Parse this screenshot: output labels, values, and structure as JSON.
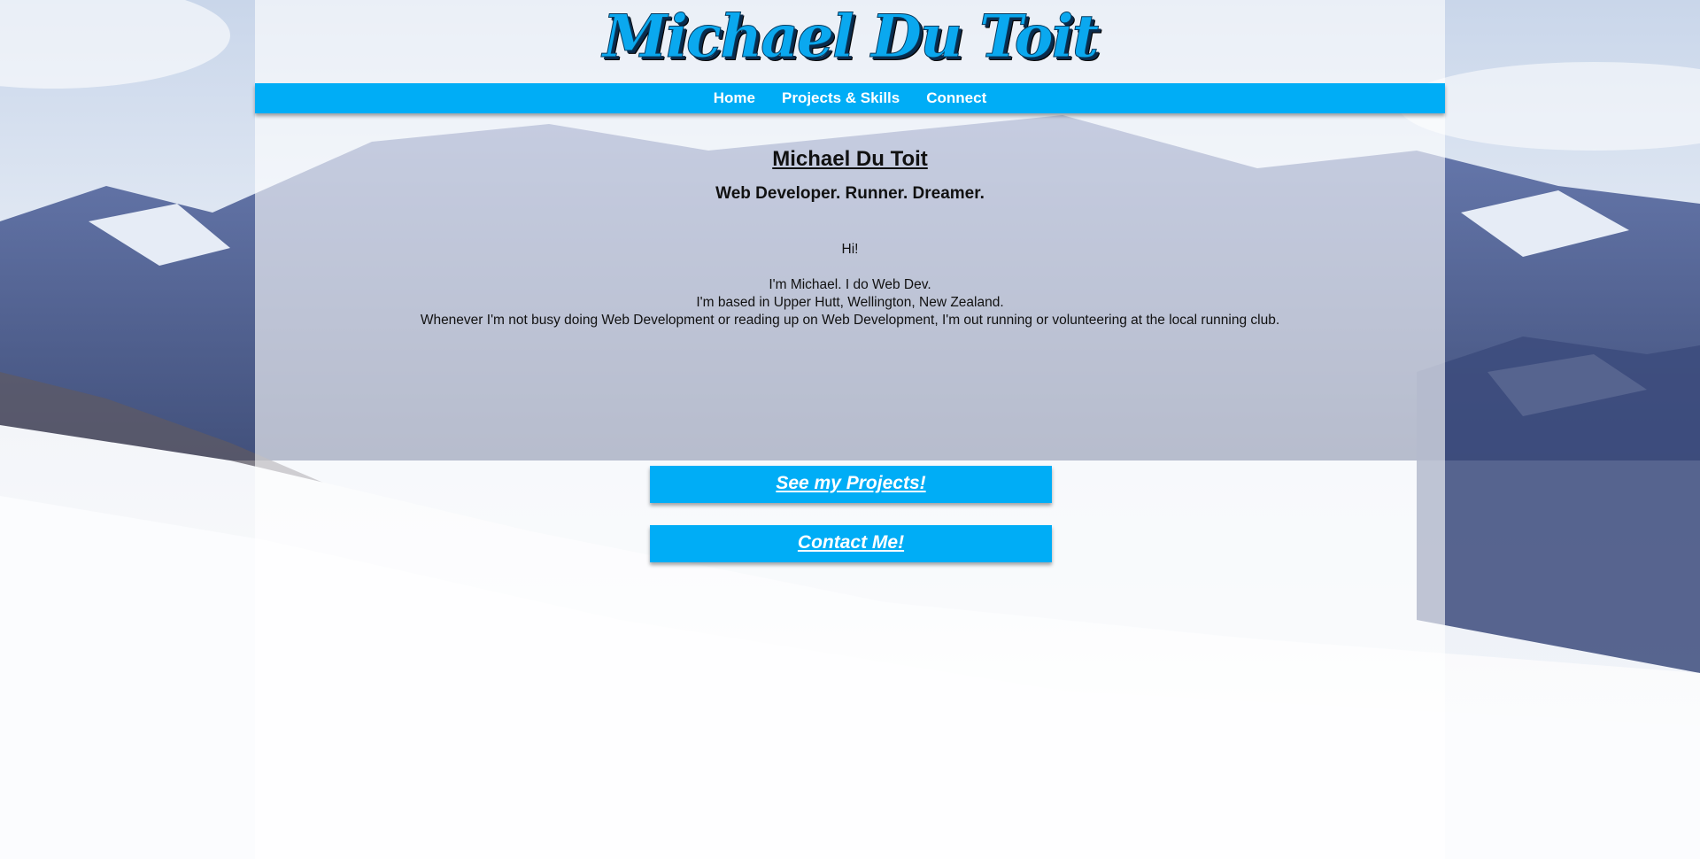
{
  "site": {
    "logo_text": "Michael Du Toit"
  },
  "nav": {
    "items": [
      {
        "label": "Home"
      },
      {
        "label": "Projects & Skills"
      },
      {
        "label": "Connect"
      }
    ]
  },
  "main": {
    "heading": "Michael Du Toit",
    "tagline": "Web Developer. Runner. Dreamer.",
    "greeting": "Hi!",
    "intro_lines": [
      "I'm Michael. I do Web Dev.",
      "I'm based in Upper Hutt, Wellington, New Zealand.",
      "Whenever I'm not busy doing Web Development or reading up on Web Development, I'm out running or volunteering at the local running club."
    ]
  },
  "buttons": {
    "projects_label": "See my Projects!",
    "contact_label": "Contact Me!"
  },
  "colors": {
    "accent": "#00adf6",
    "logo_text": "#0aa8ef",
    "nav_text": "#ffffff"
  }
}
